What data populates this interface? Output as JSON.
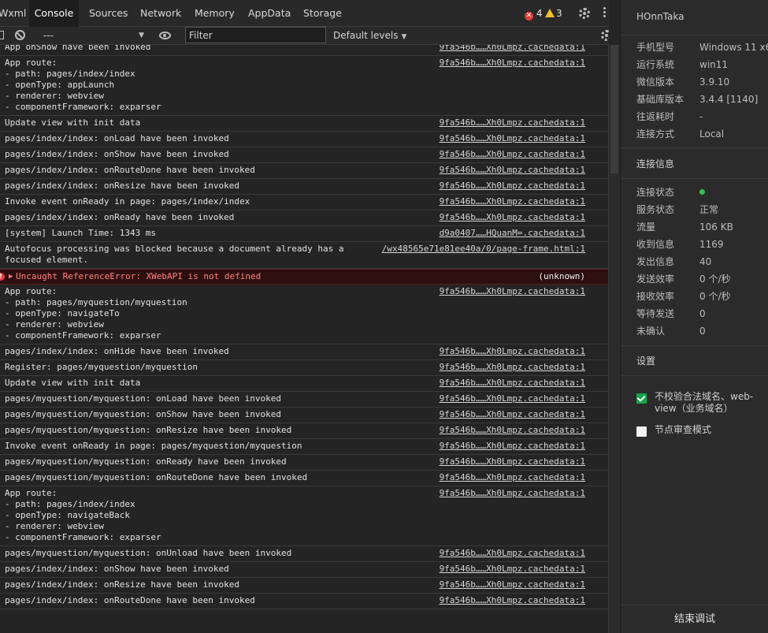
{
  "tabs": {
    "wxml": "Wxml",
    "console": "Console",
    "sources": "Sources",
    "network": "Network",
    "memory": "Memory",
    "appdata": "AppData",
    "storage": "Storage"
  },
  "badges": {
    "errors": "4",
    "warnings": "3"
  },
  "toolbar": {
    "context": "---",
    "filter_placeholder": "Filter",
    "levels": "Default levels"
  },
  "logs": [
    {
      "msg": "App onShow have been invoked",
      "src": "9fa546b……Xh0Lmpz.cachedata:1"
    },
    {
      "msg": "App route:\n- path: pages/index/index\n- openType: appLaunch\n- renderer: webview\n- componentFramework: exparser",
      "src": "9fa546b……Xh0Lmpz.cachedata:1"
    },
    {
      "msg": "Update view with init data",
      "src": "9fa546b……Xh0Lmpz.cachedata:1"
    },
    {
      "msg": "pages/index/index: onLoad have been invoked",
      "src": "9fa546b……Xh0Lmpz.cachedata:1"
    },
    {
      "msg": "pages/index/index: onShow have been invoked",
      "src": "9fa546b……Xh0Lmpz.cachedata:1"
    },
    {
      "msg": "pages/index/index: onRouteDone have been invoked",
      "src": "9fa546b……Xh0Lmpz.cachedata:1"
    },
    {
      "msg": "pages/index/index: onResize have been invoked",
      "src": "9fa546b……Xh0Lmpz.cachedata:1"
    },
    {
      "msg": "Invoke event onReady in page: pages/index/index",
      "src": "9fa546b……Xh0Lmpz.cachedata:1"
    },
    {
      "msg": "pages/index/index: onReady have been invoked",
      "src": "9fa546b……Xh0Lmpz.cachedata:1"
    },
    {
      "msg": "[system] Launch Time: 1343 ms",
      "src": "d9a0407……HQuanM=.cachedata:1"
    },
    {
      "msg": "Autofocus processing was blocked because a document already has a\nfocused element.",
      "src": "/wx48565e71e81ee40a/0/page-frame.html:1"
    },
    {
      "msg": "Uncaught ReferenceError: XWebAPI is not defined",
      "src": "(unknown)",
      "level": "error"
    },
    {
      "msg": "App route:\n- path: pages/myquestion/myquestion\n- openType: navigateTo\n- renderer: webview\n- componentFramework: exparser",
      "src": "9fa546b……Xh0Lmpz.cachedata:1"
    },
    {
      "msg": "pages/index/index: onHide have been invoked",
      "src": "9fa546b……Xh0Lmpz.cachedata:1"
    },
    {
      "msg": "Register: pages/myquestion/myquestion",
      "src": "9fa546b……Xh0Lmpz.cachedata:1"
    },
    {
      "msg": "Update view with init data",
      "src": "9fa546b……Xh0Lmpz.cachedata:1"
    },
    {
      "msg": "pages/myquestion/myquestion: onLoad have been invoked",
      "src": "9fa546b……Xh0Lmpz.cachedata:1"
    },
    {
      "msg": "pages/myquestion/myquestion: onShow have been invoked",
      "src": "9fa546b……Xh0Lmpz.cachedata:1"
    },
    {
      "msg": "pages/myquestion/myquestion: onResize have been invoked",
      "src": "9fa546b……Xh0Lmpz.cachedata:1"
    },
    {
      "msg": "Invoke event onReady in page: pages/myquestion/myquestion",
      "src": "9fa546b……Xh0Lmpz.cachedata:1"
    },
    {
      "msg": "pages/myquestion/myquestion: onReady have been invoked",
      "src": "9fa546b……Xh0Lmpz.cachedata:1"
    },
    {
      "msg": "pages/myquestion/myquestion: onRouteDone have been invoked",
      "src": "9fa546b……Xh0Lmpz.cachedata:1"
    },
    {
      "msg": "App route:\n- path: pages/index/index\n- openType: navigateBack\n- renderer: webview\n- componentFramework: exparser",
      "src": "9fa546b……Xh0Lmpz.cachedata:1"
    },
    {
      "msg": "pages/myquestion/myquestion: onUnload have been invoked",
      "src": "9fa546b……Xh0Lmpz.cachedata:1"
    },
    {
      "msg": "pages/index/index: onShow have been invoked",
      "src": "9fa546b……Xh0Lmpz.cachedata:1"
    },
    {
      "msg": "pages/index/index: onResize have been invoked",
      "src": "9fa546b……Xh0Lmpz.cachedata:1"
    },
    {
      "msg": "pages/index/index: onRouteDone have been invoked",
      "src": "9fa546b……Xh0Lmpz.cachedata:1"
    }
  ],
  "panel": {
    "device": "HOnnTaka",
    "info": [
      {
        "k": "手机型号",
        "v": "Windows 11 x64"
      },
      {
        "k": "运行系统",
        "v": "win11"
      },
      {
        "k": "微信版本",
        "v": "3.9.10"
      },
      {
        "k": "基础库版本",
        "v": "3.4.4 [1140]"
      },
      {
        "k": "往返耗时",
        "v": "-"
      },
      {
        "k": "连接方式",
        "v": "Local"
      }
    ],
    "conn_title": "连接信息",
    "conn": [
      {
        "k": "连接状态",
        "v": ""
      },
      {
        "k": "服务状态",
        "v": "正常"
      },
      {
        "k": "流量",
        "v": "106 KB"
      },
      {
        "k": "收到信息",
        "v": "1169"
      },
      {
        "k": "发出信息",
        "v": "40"
      },
      {
        "k": "发送效率",
        "v": "0 个/秒"
      },
      {
        "k": "接收效率",
        "v": "0 个/秒"
      },
      {
        "k": "等待发送",
        "v": "0"
      },
      {
        "k": "未确认",
        "v": "0"
      }
    ],
    "settings_title": "设置",
    "check1": "不校验合法域名、web-view（业务域名）",
    "check2": "节点审查模式",
    "end_button": "结束调试"
  }
}
